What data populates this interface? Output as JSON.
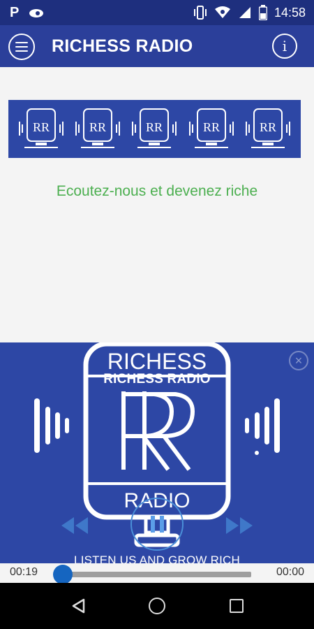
{
  "status_bar": {
    "time": "14:58",
    "left_icons": [
      "parking-icon",
      "eye-icon"
    ],
    "right_icons": [
      "vibrate-icon",
      "wifi-icon",
      "cell-signal-icon",
      "battery-icon"
    ]
  },
  "app_bar": {
    "title": "RICHESS RADIO",
    "menu_icon": "menu-icon",
    "info_icon": "info-icon"
  },
  "banner": {
    "logo_count": 5,
    "logo_text": "RR"
  },
  "tagline": "Ecoutez-nous et devenez riche",
  "player": {
    "station_name": "RICHESS RADIO",
    "logo_top_text": "RICHESS",
    "logo_bottom_text": "RADIO",
    "slogan": "LISTEN US AND GROW RICH",
    "close_symbol": "×",
    "elapsed": "00:19",
    "total": "00:00",
    "progress_fraction": 0.0
  },
  "colors": {
    "primary": "#2b3f9a",
    "status": "#1e2f7e",
    "tagline": "#4caf50",
    "player_bg": "#2d47a5",
    "accent": "#1565c0"
  },
  "nav": {
    "icons": [
      "back-icon",
      "home-icon",
      "recent-apps-icon"
    ]
  }
}
